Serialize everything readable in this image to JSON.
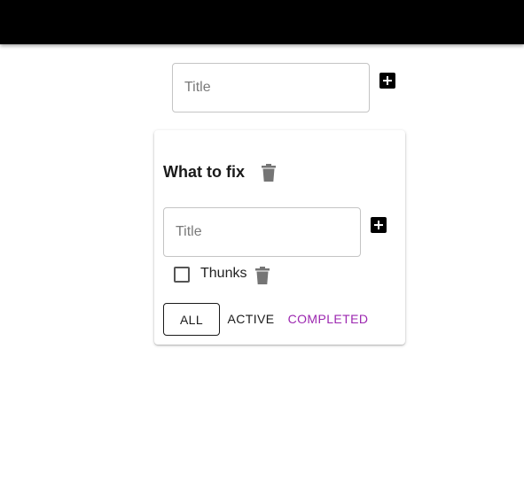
{
  "top_form": {
    "title_placeholder": "Title"
  },
  "todolist": {
    "title": "What to fix",
    "add_task": {
      "title_placeholder": "Title"
    },
    "tasks": [
      {
        "label": "Thunks",
        "done": false
      }
    ],
    "filters": [
      {
        "label": "ALL",
        "variant": "outlined",
        "color": "#1a1a1a"
      },
      {
        "label": "ACTIVE",
        "variant": "text",
        "color": "#1a1a1a"
      },
      {
        "label": "COMPLETED",
        "variant": "text",
        "color": "#9c27b0"
      }
    ]
  },
  "icons": {
    "add": "add-box-icon",
    "delete": "trash-icon"
  },
  "colors": {
    "appbar": "#000000",
    "accent": "#9c27b0",
    "icon_gray": "#757575"
  }
}
